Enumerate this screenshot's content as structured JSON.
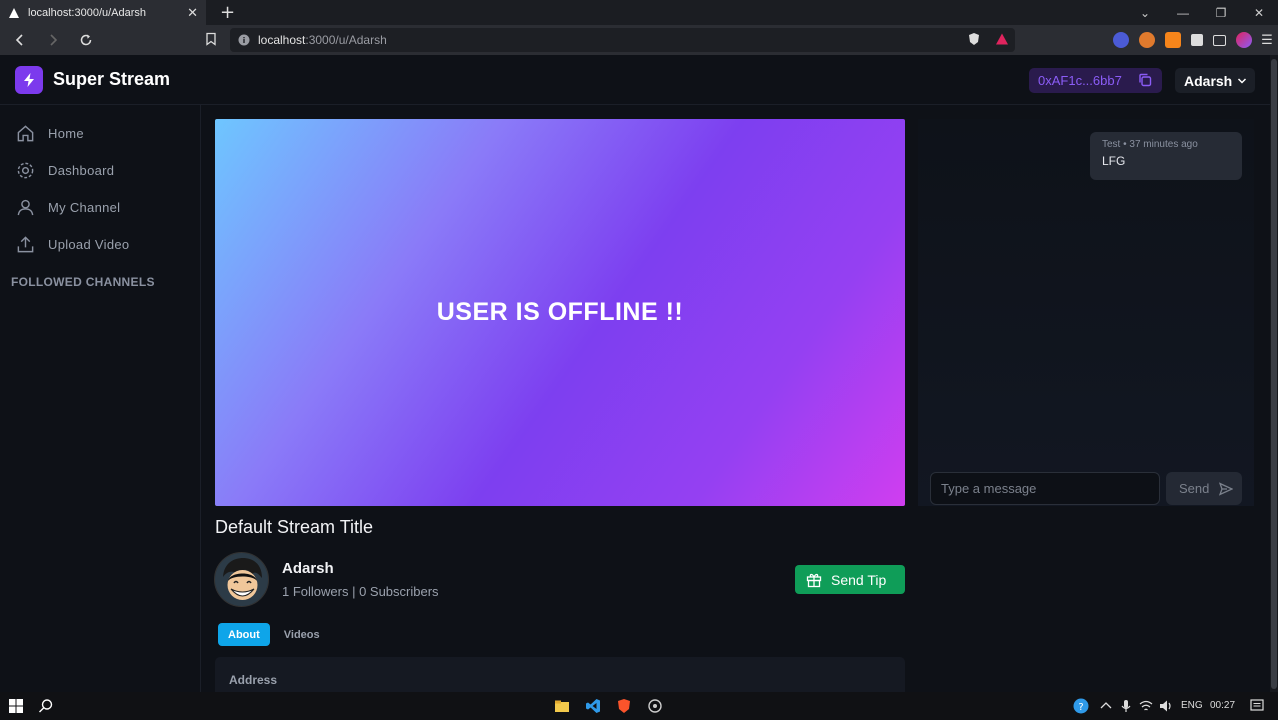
{
  "browser": {
    "tab_title": "localhost:3000/u/Adarsh",
    "url_host": "localhost",
    "url_rest": ":3000/u/Adarsh"
  },
  "header": {
    "brand": "Super Stream",
    "wallet": "0xAF1c...6bb7",
    "user": "Adarsh"
  },
  "sidebar": {
    "items": [
      {
        "label": "Home",
        "icon": "home-icon"
      },
      {
        "label": "Dashboard",
        "icon": "gear-icon"
      },
      {
        "label": "My Channel",
        "icon": "user-icon"
      },
      {
        "label": "Upload Video",
        "icon": "upload-icon"
      }
    ],
    "section_heading": "FOLLOWED CHANNELS"
  },
  "player": {
    "status": "USER IS OFFLINE !!"
  },
  "stream": {
    "title": "Default Stream Title",
    "channel_name": "Adarsh",
    "stats": "1 Followers | 0 Subscribers",
    "tip_label": "Send Tip"
  },
  "tabs": [
    {
      "label": "About",
      "active": true
    },
    {
      "label": "Videos",
      "active": false
    }
  ],
  "about": {
    "label": "Address"
  },
  "chat": {
    "messages": [
      {
        "author": "Test",
        "time": "37 minutes ago",
        "text": "LFG"
      }
    ],
    "placeholder": "Type a message",
    "send_label": "Send"
  },
  "taskbar": {
    "lang": "ENG",
    "time": "00:27"
  },
  "colors": {
    "accent": "#7c3aed",
    "tip_green": "#0f9d58",
    "tab_active": "#0ea5e9"
  }
}
